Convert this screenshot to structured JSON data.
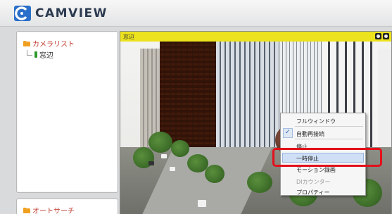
{
  "app": {
    "logo_text": "CAMVIEW",
    "colors": {
      "header_bg": "#eeeeee",
      "accent_red": "#e3101b",
      "viewer_title_bar": "#ece21d",
      "tree_label": "#c0392b"
    }
  },
  "sidebar": {
    "camera_list_label": "カメラリスト",
    "camera_items": [
      {
        "label": "窓辺",
        "icon": "camera-icon"
      }
    ],
    "auto_search_label": "オートサーチ"
  },
  "viewer": {
    "title": "窓辺"
  },
  "context_menu": {
    "items": [
      {
        "label": "フルウィンドウ",
        "checked": false,
        "disabled": false
      },
      {
        "label": "自動再接続",
        "checked": true,
        "disabled": false
      },
      {
        "label": "停止",
        "checked": false,
        "disabled": false
      },
      {
        "label": "一時停止",
        "checked": false,
        "disabled": false,
        "highlighted": true
      },
      {
        "label": "モーション録画",
        "checked": false,
        "disabled": false
      },
      {
        "label": "DIカウンター",
        "checked": false,
        "disabled": true
      },
      {
        "label": "プロパティー",
        "checked": false,
        "disabled": false
      }
    ],
    "check_glyph": "✓"
  }
}
